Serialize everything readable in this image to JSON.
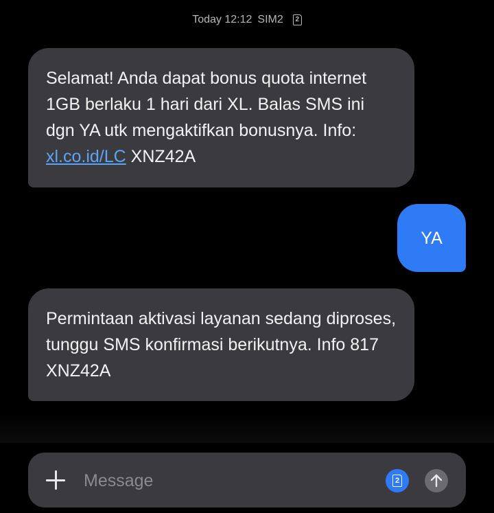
{
  "header": {
    "timestamp": "Today 12:12",
    "sim_label": "SIM2",
    "sim_number": "2"
  },
  "messages": [
    {
      "direction": "incoming",
      "text_before_link": "Selamat! Anda dapat bonus quota internet 1GB berlaku 1 hari dari XL. Balas SMS ini dgn YA utk mengaktifkan bonusnya. Info: ",
      "link_text": "xl.co.id/LC",
      "text_after_link": " XNZ42A"
    },
    {
      "direction": "outgoing",
      "text": "YA"
    },
    {
      "direction": "incoming",
      "text": "Permintaan aktivasi layanan sedang diproses, tunggu SMS konfirmasi berikutnya. Info 817 XNZ42A"
    }
  ],
  "composer": {
    "placeholder": "Message",
    "value": "",
    "sim_number": "2"
  },
  "icons": {
    "attach": "plus-icon",
    "sim": "sim-card-icon",
    "send": "arrow-up-icon"
  },
  "colors": {
    "background": "#000000",
    "incoming_bubble": "#3b3b3f",
    "outgoing_bubble": "#2f7bf5",
    "link": "#5ca4f5"
  }
}
